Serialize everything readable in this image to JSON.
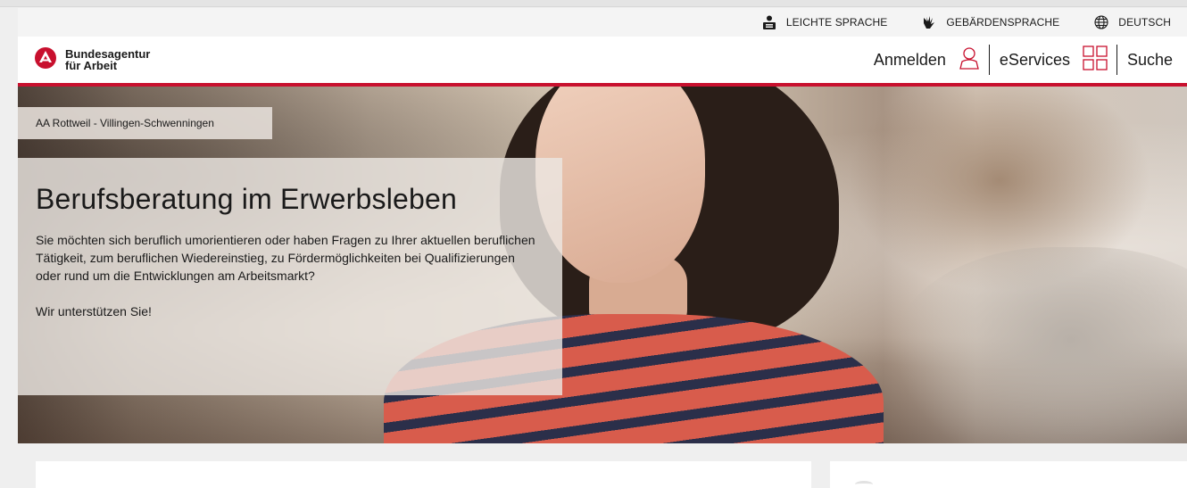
{
  "utility_bar": {
    "easy_language": "LEICHTE SPRACHE",
    "sign_language": "GEBÄRDENSPRACHE",
    "language": "DEUTSCH"
  },
  "header": {
    "logo_line1": "Bundesagentur",
    "logo_line2": "für Arbeit",
    "login": "Anmelden",
    "eservices": "eServices",
    "search": "Suche"
  },
  "hero": {
    "location": "AA Rottweil - Villingen-Schwenningen",
    "title": "Berufsberatung im Erwerbsleben",
    "text": "Sie möchten sich beruflich umorientieren oder haben Fragen zu Ihrer aktuellen beruflichen Tätigkeit, zum beruflichen Wiedereinstieg, zu Fördermöglichkeiten bei Qualifizierungen oder rund um die Entwicklungen am Arbeitsmarkt?",
    "text2": "Wir unterstützen Sie!"
  },
  "colors": {
    "brand_red": "#c8102e",
    "text": "#1a1a1a"
  },
  "icons": [
    "easy-language-icon",
    "sign-language-icon",
    "globe-icon",
    "ba-logo-icon",
    "user-icon",
    "grid-icon"
  ]
}
